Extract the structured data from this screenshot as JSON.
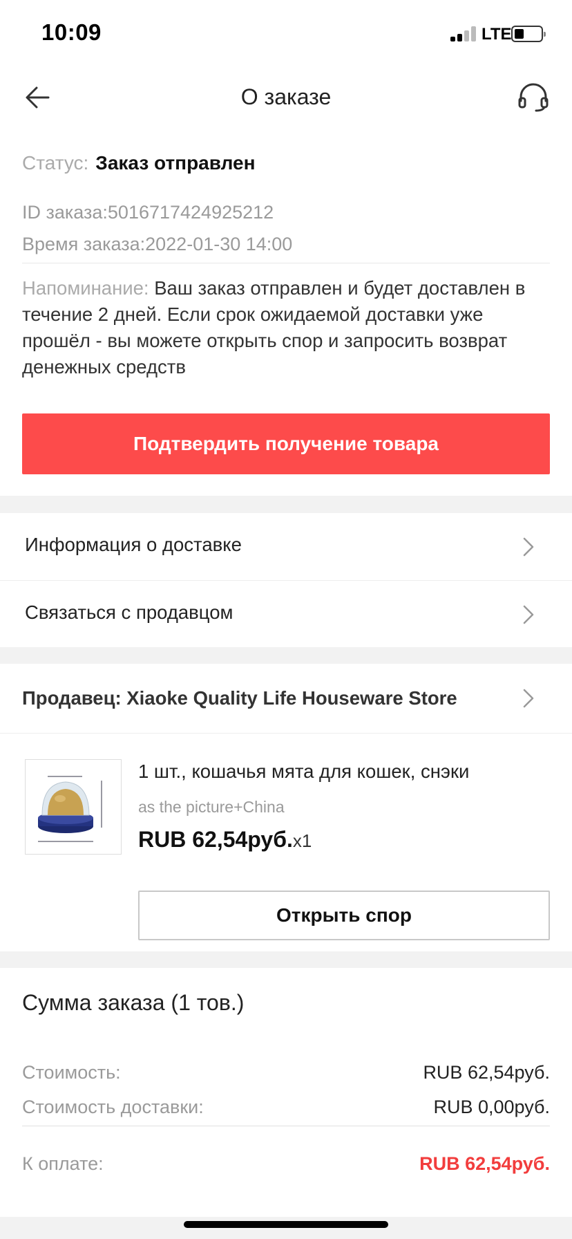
{
  "status_bar": {
    "time": "10:09",
    "network": "LTE"
  },
  "nav": {
    "title": "О заказе",
    "back_icon": "arrow-left-icon",
    "support_icon": "headset-icon"
  },
  "order": {
    "status_label": "Статус:",
    "status_value": "Заказ отправлен",
    "order_id": "ID заказа:5016717424925212",
    "order_time": "Время заказа:2022-01-30 14:00",
    "reminder_label": "Напоминание:",
    "reminder_text": " Ваш заказ отправлен и будет доставлен в течение  2 дней. Если срок ожидаемой доставки уже прошёл - вы можете открыть спор и запросить возврат денежных средств",
    "confirm_button": "Подтвердить получение товара"
  },
  "links": [
    {
      "label": "Информация о доставке"
    },
    {
      "label": "Связаться с продавцом"
    }
  ],
  "seller": {
    "name": "Продавец: Xiaoke Quality Life Houseware Store"
  },
  "product": {
    "title": "1 шт., кошачья мята для кошек, снэки",
    "variant": "as the picture+China",
    "price": "RUB 62,54руб.",
    "quantity": "x1",
    "dispute_button": "Открыть спор"
  },
  "summary": {
    "title": "Сумма заказа (1 тов.)",
    "cost_label": "Стоимость:",
    "cost_value": "RUB 62,54руб.",
    "shipping_label": "Стоимость доставки:",
    "shipping_value": "RUB 0,00руб.",
    "total_label": "К оплате:",
    "total_value": "RUB 62,54руб."
  },
  "colors": {
    "accent": "#fd4b4b",
    "total": "#f23d3d"
  }
}
